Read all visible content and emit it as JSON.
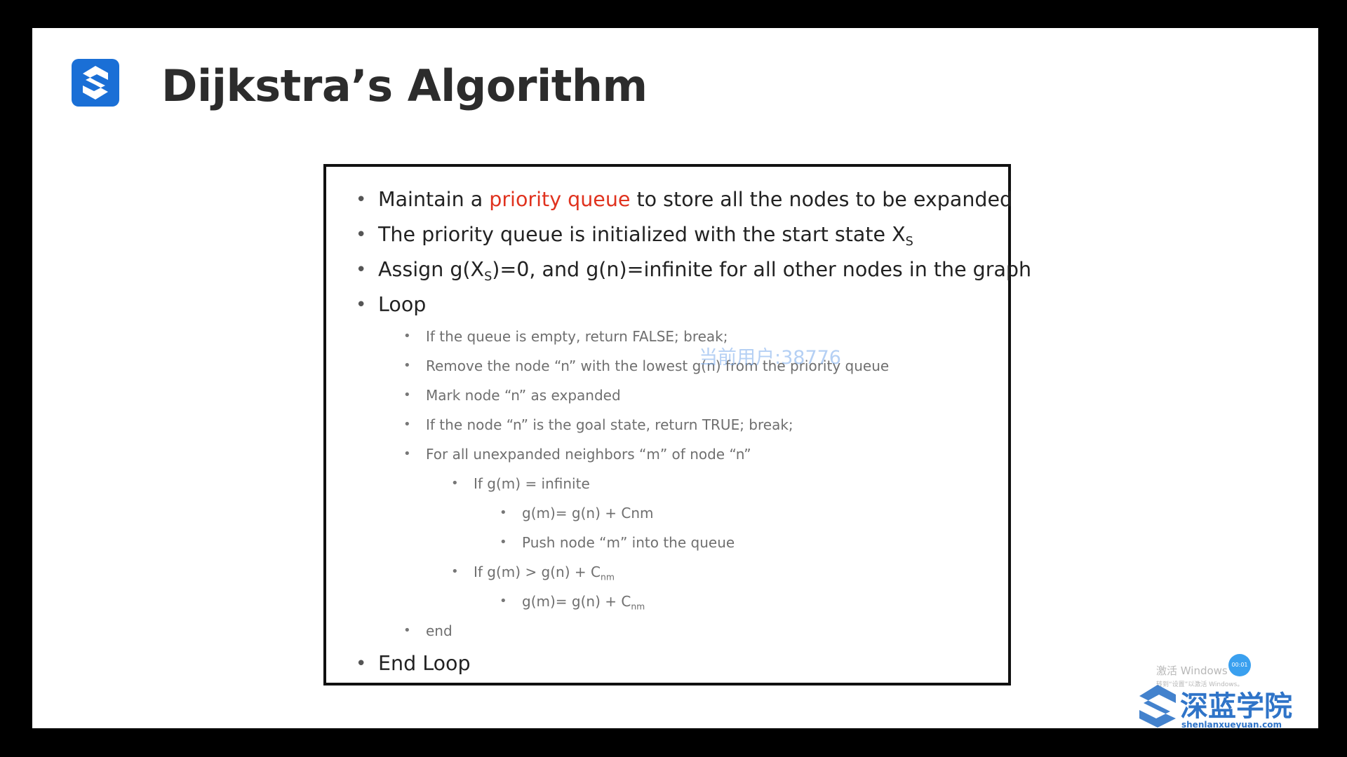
{
  "slide": {
    "title": "Dijkstra’s Algorithm"
  },
  "bullets": {
    "b1_pre": "Maintain a ",
    "b1_hl": "priority queue",
    "b1_post": " to store all the nodes to be expanded",
    "b2_pre": "The priority queue is initialized with the start state X",
    "b2_sub": "S",
    "b3_pre": "Assign g(X",
    "b3_sub": "S",
    "b3_post": ")=0, and g(n)=infinite for all other nodes in the graph",
    "b4": "Loop",
    "l1": "If the queue is empty, return FALSE; break;",
    "l2": "Remove the node “n” with the lowest g(n) from the priority queue",
    "l3": "Mark node “n” as expanded",
    "l4": "If the node “n” is the goal state, return TRUE; break;",
    "l5": "For all unexpanded neighbors “m” of node “n”",
    "l6": "If g(m) = infinite",
    "l7": "g(m)= g(n) + Cnm",
    "l8": "Push node “m” into the queue",
    "l9_pre": "If g(m) > g(n) + C",
    "l9_sub": "nm",
    "l10_pre": "g(m)= g(n) + C",
    "l10_sub": "nm",
    "l11": "end",
    "b5": "End Loop"
  },
  "watermarks": {
    "user": "当前用户:38776",
    "windows_line1": "激活 Windows",
    "windows_line2": "转到“设置”以激活 Windows。",
    "rec_badge": "00:01",
    "brand_name": "深蓝学院",
    "brand_url": "shenlanxueyuan.com"
  },
  "colors": {
    "highlight": "#e0321e",
    "logo_blue": "#1a6fd6",
    "brand_blue": "#2f74c8"
  },
  "icons": {
    "slide_logo": "shenlan-logo-icon",
    "brand_logo": "shenlan-brand-icon",
    "bullet": "bullet-dot"
  }
}
